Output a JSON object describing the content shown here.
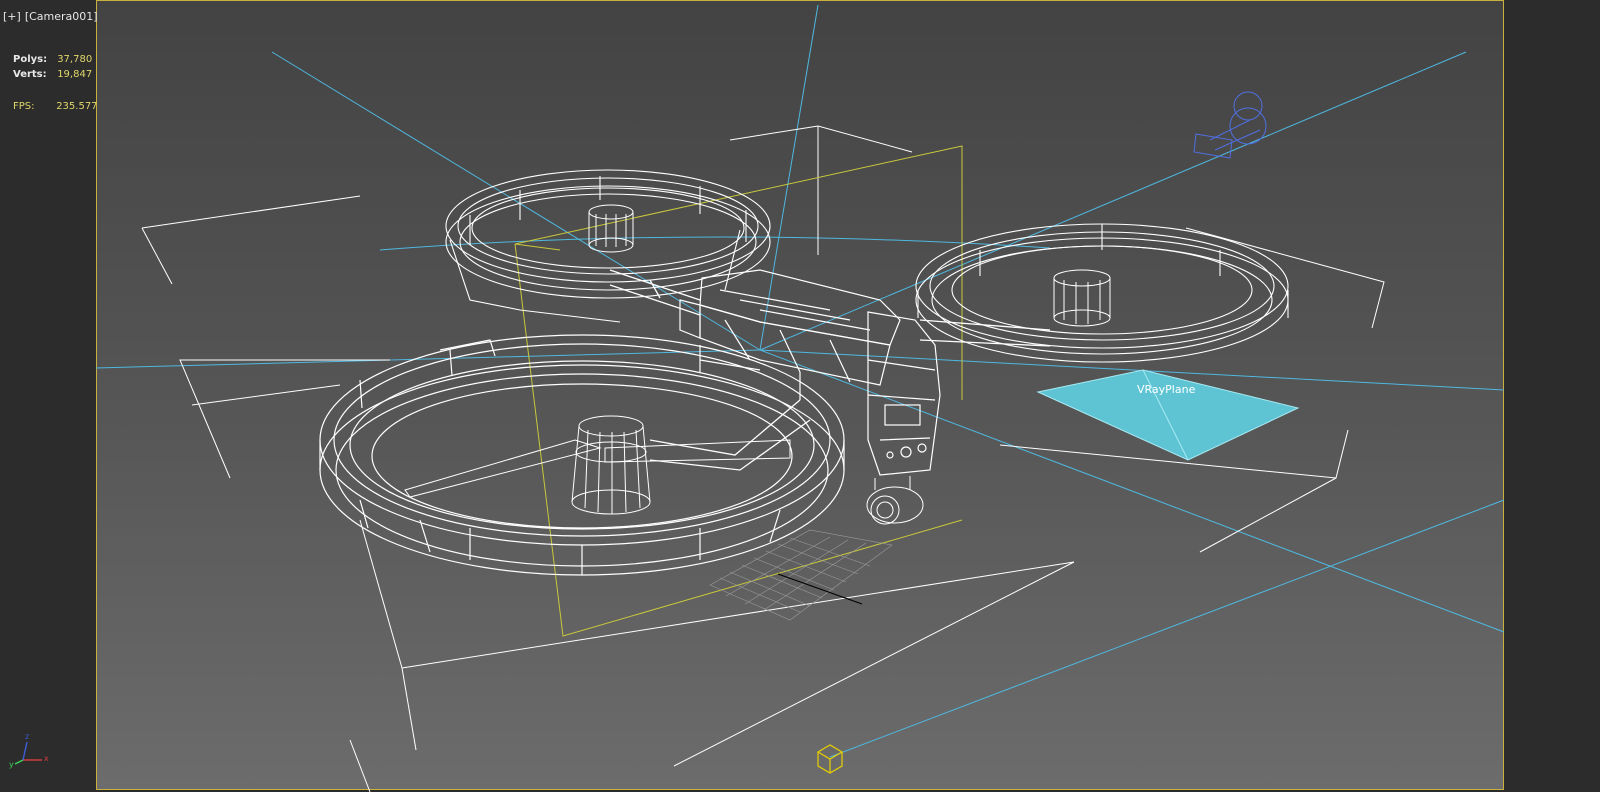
{
  "viewport": {
    "plus_label": "[+]",
    "camera_label": "[Camera001]"
  },
  "stats": {
    "polys_label": "Polys:",
    "polys_value": "37,780",
    "verts_label": "Verts:",
    "verts_value": "19,847",
    "fps_label": "FPS:",
    "fps_value": "235.577"
  },
  "scene": {
    "object_label": "VRayPlane",
    "wire_color": "#ffffff",
    "bbox_color": "#ffffff",
    "selection_color": "#c8c83c",
    "light_color": "#4fb8e0",
    "plane_color": "#5ec4d4",
    "camera_icon_color": "#4f6fe0",
    "gizmo_color": "#e8d000"
  },
  "axis_gizmo": {
    "x": "x",
    "y": "y",
    "z": "z"
  }
}
